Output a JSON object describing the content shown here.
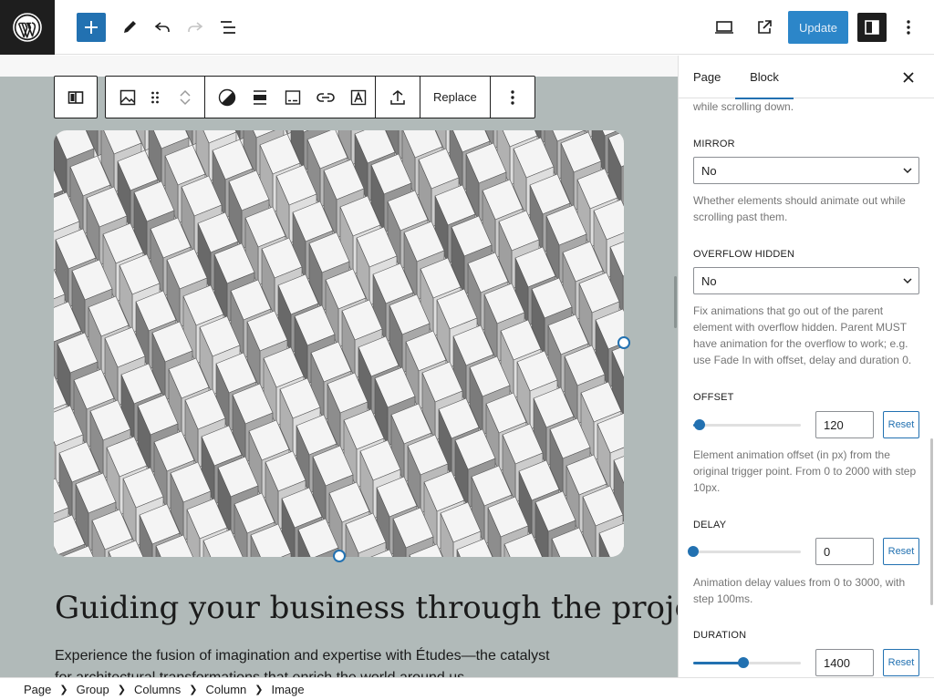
{
  "toolbar": {
    "update_label": "Update"
  },
  "block_toolbar": {
    "replace_label": "Replace"
  },
  "canvas": {
    "heading": "Guiding your business through the project",
    "paragraph": "Experience the fusion of imagination and expertise with Études—the catalyst",
    "paragraph_cut": "for architectural transformations that enrich the world around us."
  },
  "sidebar": {
    "tabs": [
      {
        "label": "Page",
        "active": false
      },
      {
        "label": "Block",
        "active": true
      }
    ],
    "top_help": "while scrolling down.",
    "mirror": {
      "label": "MIRROR",
      "value": "No",
      "help": "Whether elements should animate out while scrolling past them."
    },
    "overflow": {
      "label": "OVERFLOW HIDDEN",
      "value": "No",
      "help": "Fix animations that go out of the parent element with overflow hidden. Parent MUST have animation for the overflow to work; e.g. use Fade In with offset, delay and duration 0."
    },
    "offset": {
      "label": "OFFSET",
      "value": "120",
      "min": 0,
      "max": 2000,
      "reset": "Reset",
      "help": "Element animation offset (in px) from the original trigger point. From 0 to 2000 with step 10px."
    },
    "delay": {
      "label": "DELAY",
      "value": "0",
      "min": 0,
      "max": 3000,
      "reset": "Reset",
      "help": "Animation delay values from 0 to 3000, with step 100ms."
    },
    "duration": {
      "label": "DURATION",
      "value": "1400",
      "min": 0,
      "max": 3000,
      "reset": "Reset"
    }
  },
  "breadcrumb": [
    "Page",
    "Group",
    "Columns",
    "Column",
    "Image"
  ],
  "colors": {
    "accent": "#2271b1",
    "canvas_bg": "#b1bab9",
    "dark": "#1e1e1e"
  }
}
